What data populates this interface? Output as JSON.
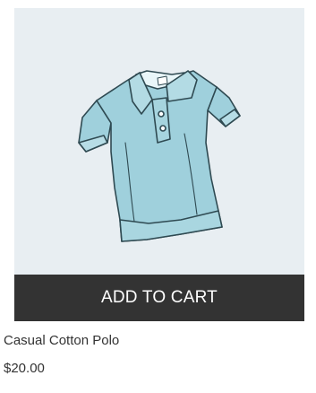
{
  "product": {
    "image_icon": "polo-shirt-icon",
    "name": "Casual Cotton Polo",
    "price": "$20.00",
    "add_to_cart_label": "ADD TO CART"
  },
  "colors": {
    "image_background": "#e8eef2",
    "shirt": "#9fd0dc",
    "button_background": "#333333",
    "button_text": "#ffffff",
    "text": "#333333"
  }
}
